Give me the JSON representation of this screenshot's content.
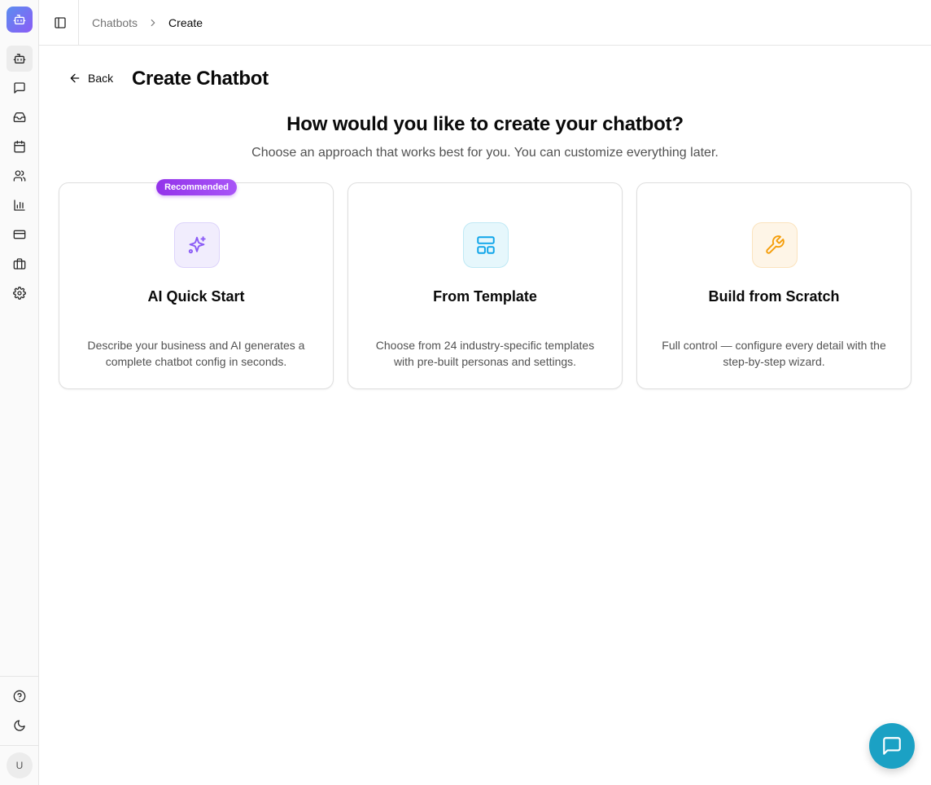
{
  "sidebar": {
    "logo_icon": "bot-icon",
    "nav": [
      {
        "icon": "bot-icon",
        "active": true
      },
      {
        "icon": "message-square-icon",
        "active": false
      },
      {
        "icon": "inbox-icon",
        "active": false
      },
      {
        "icon": "calendar-icon",
        "active": false
      },
      {
        "icon": "users-icon",
        "active": false
      },
      {
        "icon": "bar-chart-icon",
        "active": false
      },
      {
        "icon": "credit-card-icon",
        "active": false
      },
      {
        "icon": "briefcase-icon",
        "active": false
      },
      {
        "icon": "settings-icon",
        "active": false
      }
    ],
    "bottom": [
      {
        "icon": "help-circle-icon"
      },
      {
        "icon": "moon-icon"
      }
    ],
    "avatar_initial": "U"
  },
  "header": {
    "breadcrumbs": [
      "Chatbots",
      "Create"
    ]
  },
  "page": {
    "back_label": "Back",
    "title": "Create Chatbot",
    "question": "How would you like to create your chatbot?",
    "subtitle": "Choose an approach that works best for you. You can customize everything later."
  },
  "options": [
    {
      "title": "AI Quick Start",
      "description": "Describe your business and AI generates a complete chatbot config in seconds.",
      "badge": "Recommended",
      "icon": "sparkles-icon",
      "icon_color": "#8b5cf6",
      "icon_bg": "#f1edfd"
    },
    {
      "title": "From Template",
      "description": "Choose from 24 industry-specific templates with pre-built personas and settings.",
      "icon": "layout-template-icon",
      "icon_color": "#0ea5e9",
      "icon_bg": "#e6f7fc"
    },
    {
      "title": "Build from Scratch",
      "description": "Full control — configure every detail with the step-by-step wizard.",
      "icon": "wrench-icon",
      "icon_color": "#f59e0b",
      "icon_bg": "#fef5e7"
    }
  ],
  "fab": {
    "icon": "message-square-icon",
    "color": "#1ba1c4"
  }
}
